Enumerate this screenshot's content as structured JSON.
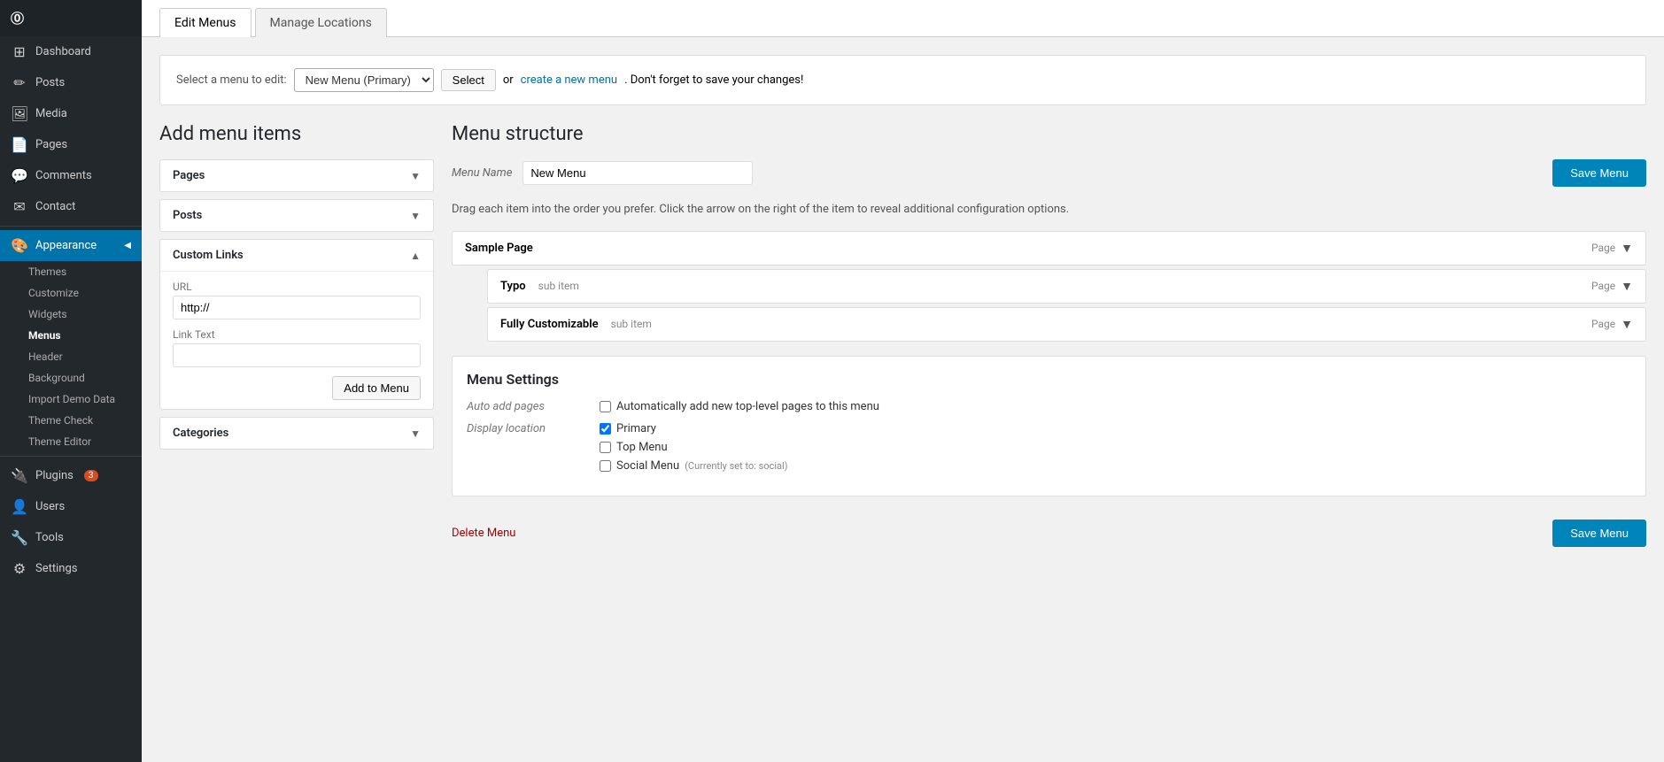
{
  "sidebar": {
    "logo": "W",
    "items": [
      {
        "id": "dashboard",
        "label": "Dashboard",
        "icon": "⊞"
      },
      {
        "id": "posts",
        "label": "Posts",
        "icon": "📝"
      },
      {
        "id": "media",
        "label": "Media",
        "icon": "🖼"
      },
      {
        "id": "pages",
        "label": "Pages",
        "icon": "📄"
      },
      {
        "id": "comments",
        "label": "Comments",
        "icon": "💬"
      },
      {
        "id": "contact",
        "label": "Contact",
        "icon": "✉"
      },
      {
        "id": "appearance",
        "label": "Appearance",
        "icon": "🎨",
        "active": true
      }
    ],
    "appearance_sub": [
      {
        "id": "themes",
        "label": "Themes"
      },
      {
        "id": "customize",
        "label": "Customize"
      },
      {
        "id": "widgets",
        "label": "Widgets"
      },
      {
        "id": "menus",
        "label": "Menus",
        "active": true
      },
      {
        "id": "header",
        "label": "Header"
      },
      {
        "id": "background",
        "label": "Background"
      },
      {
        "id": "import-demo",
        "label": "Import Demo Data"
      },
      {
        "id": "theme-check",
        "label": "Theme Check"
      },
      {
        "id": "theme-editor",
        "label": "Theme Editor"
      }
    ],
    "other_items": [
      {
        "id": "plugins",
        "label": "Plugins",
        "icon": "🔌",
        "badge": "3"
      },
      {
        "id": "users",
        "label": "Users",
        "icon": "👤"
      },
      {
        "id": "tools",
        "label": "Tools",
        "icon": "🔧"
      },
      {
        "id": "settings",
        "label": "Settings",
        "icon": "⚙"
      }
    ]
  },
  "tabs": [
    {
      "id": "edit-menus",
      "label": "Edit Menus",
      "active": true
    },
    {
      "id": "manage-locations",
      "label": "Manage Locations"
    }
  ],
  "select_bar": {
    "label": "Select a menu to edit:",
    "dropdown_value": "New Menu (Primary)",
    "select_btn": "Select",
    "or_text": "or",
    "create_link": "create a new menu",
    "dont_forget": ". Don't forget to save your changes!"
  },
  "add_menu_items": {
    "heading": "Add menu items",
    "panels": [
      {
        "id": "pages",
        "label": "Pages",
        "expanded": false
      },
      {
        "id": "posts",
        "label": "Posts",
        "expanded": false
      },
      {
        "id": "custom-links",
        "label": "Custom Links",
        "expanded": true,
        "url_label": "URL",
        "url_value": "http://",
        "link_text_label": "Link Text",
        "link_text_value": "",
        "add_btn": "Add to Menu"
      },
      {
        "id": "categories",
        "label": "Categories",
        "expanded": false
      }
    ]
  },
  "menu_structure": {
    "heading": "Menu structure",
    "menu_name_label": "Menu Name",
    "menu_name_value": "New Menu",
    "save_btn": "Save Menu",
    "drag_hint": "Drag each item into the order you prefer. Click the arrow on the right of the item to reveal additional configuration options.",
    "items": [
      {
        "id": "sample-page",
        "name": "Sample Page",
        "type": "Page",
        "sub": false
      },
      {
        "id": "typo",
        "name": "Typo",
        "sub_label": "sub item",
        "type": "Page",
        "sub": true
      },
      {
        "id": "fully-customizable",
        "name": "Fully Customizable",
        "sub_label": "sub item",
        "type": "Page",
        "sub": true
      }
    ]
  },
  "menu_settings": {
    "heading": "Menu Settings",
    "auto_add_label": "Auto add pages",
    "auto_add_text": "Automatically add new top-level pages to this menu",
    "auto_add_checked": false,
    "display_location_label": "Display location",
    "locations": [
      {
        "id": "primary",
        "label": "Primary",
        "checked": true
      },
      {
        "id": "top-menu",
        "label": "Top Menu",
        "checked": false
      },
      {
        "id": "social-menu",
        "label": "Social Menu",
        "note": "(Currently set to: social)",
        "checked": false
      }
    ]
  },
  "footer": {
    "delete_link": "Delete Menu",
    "save_btn": "Save Menu"
  }
}
